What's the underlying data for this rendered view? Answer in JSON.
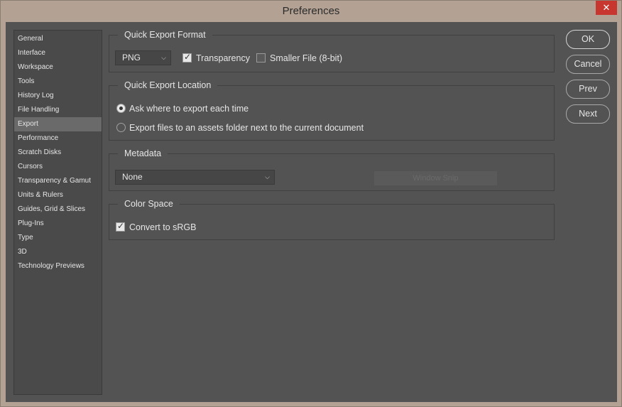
{
  "window": {
    "title": "Preferences",
    "close_glyph": "✕"
  },
  "sidebar": {
    "items": [
      {
        "label": "General"
      },
      {
        "label": "Interface"
      },
      {
        "label": "Workspace"
      },
      {
        "label": "Tools"
      },
      {
        "label": "History Log"
      },
      {
        "label": "File Handling"
      },
      {
        "label": "Export",
        "selected": true
      },
      {
        "label": "Performance"
      },
      {
        "label": "Scratch Disks"
      },
      {
        "label": "Cursors"
      },
      {
        "label": "Transparency & Gamut"
      },
      {
        "label": "Units & Rulers"
      },
      {
        "label": "Guides, Grid & Slices"
      },
      {
        "label": "Plug-Ins"
      },
      {
        "label": "Type"
      },
      {
        "label": "3D"
      },
      {
        "label": "Technology Previews"
      }
    ]
  },
  "quick_export_format": {
    "title": "Quick Export Format",
    "format_value": "PNG",
    "transparency_label": "Transparency",
    "transparency_checked": true,
    "smaller_file_label": "Smaller File (8-bit)",
    "smaller_file_checked": false
  },
  "quick_export_location": {
    "title": "Quick Export Location",
    "option_ask": "Ask where to export each time",
    "option_assets": "Export files to an assets folder next to the current document",
    "selected": "ask"
  },
  "metadata": {
    "title": "Metadata",
    "value": "None",
    "ghost_button": "Window Snip"
  },
  "color_space": {
    "title": "Color Space",
    "convert_label": "Convert to sRGB",
    "convert_checked": true
  },
  "buttons": {
    "ok": "OK",
    "cancel": "Cancel",
    "prev": "Prev",
    "next": "Next"
  },
  "icons": {
    "chevron": "chevron-down-icon",
    "check": "checkmark-icon"
  },
  "colors": {
    "panel": "#535353",
    "frame": "#b3a293",
    "close": "#c7372f"
  }
}
